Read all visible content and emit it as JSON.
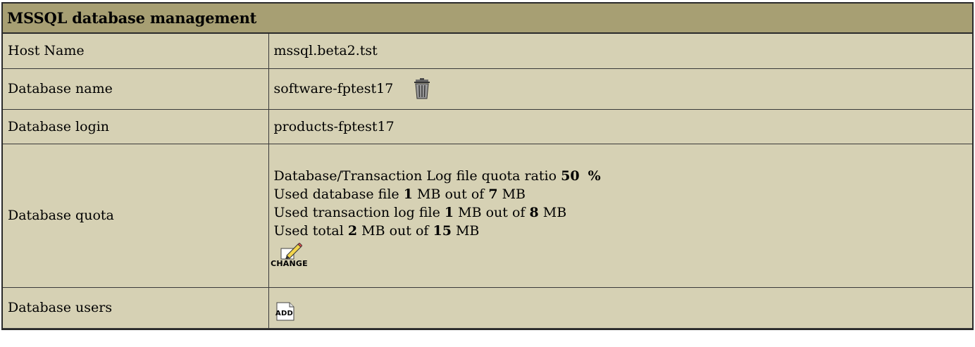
{
  "panel": {
    "title": "MSSQL database management"
  },
  "rows": {
    "host": {
      "label": "Host Name",
      "value": "mssql.beta2.tst"
    },
    "dbname": {
      "label": "Database name",
      "value": "software-fptest17",
      "icon": "trash-icon"
    },
    "login": {
      "label": "Database login",
      "value": "products-fptest17"
    },
    "quota": {
      "label": "Database quota",
      "ratio_prefix": "Database/Transaction Log file quota ratio ",
      "ratio_value": "50",
      "ratio_unit": "%",
      "db_prefix": "Used database file ",
      "db_used": "1",
      "db_mid": " MB out of ",
      "db_total": "7",
      "db_suffix": " MB",
      "log_prefix": "Used transaction log file ",
      "log_used": "1",
      "log_mid": " MB out of ",
      "log_total": "8",
      "log_suffix": " MB",
      "total_prefix": "Used total ",
      "total_used": "2",
      "total_mid": " MB out of ",
      "total_total": "15",
      "total_suffix": " MB",
      "change_label": "CHANGE",
      "change_icon": "pencil-edit-icon"
    },
    "users": {
      "label": "Database users",
      "add_label": "ADD",
      "add_icon": "document-add-icon"
    }
  },
  "colors": {
    "header_bg": "#a79f73",
    "panel_bg": "#d6d1b4",
    "border": "#2a2a2a"
  }
}
